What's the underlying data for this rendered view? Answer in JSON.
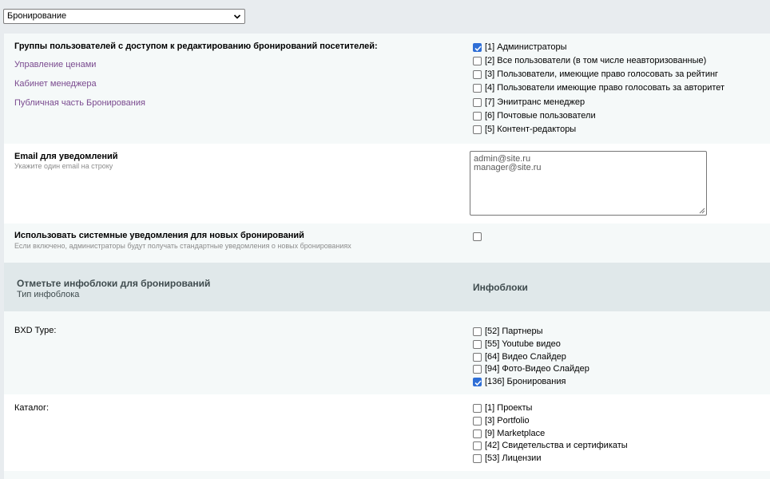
{
  "module_select": {
    "value": "Бронирование"
  },
  "access": {
    "label": "Группы пользователей с доступом к редактированию бронирований посетителей:",
    "links": [
      "Управление ценами",
      "Кабинет менеджера",
      "Публичная часть Бронирования"
    ],
    "groups": [
      {
        "label": "[1] Администраторы",
        "checked": true
      },
      {
        "label": "[2] Все пользователи (в том числе неавторизованные)",
        "checked": false
      },
      {
        "label": "[3] Пользователи, имеющие право голосовать за рейтинг",
        "checked": false
      },
      {
        "label": "[4] Пользователи имеющие право голосовать за авторитет",
        "checked": false
      },
      {
        "label": "[7] Эниитранс менеджер",
        "checked": false
      },
      {
        "label": "[6] Почтовые пользователи",
        "checked": false
      },
      {
        "label": "[5] Контент-редакторы",
        "checked": false
      }
    ]
  },
  "email": {
    "label": "Email для уведомлений",
    "hint": "Укажите один email на строку",
    "lines": [
      "admin@site.ru",
      "manager@site.ru"
    ]
  },
  "system_notify": {
    "label": "Использовать системные уведомления для новых бронирований",
    "hint": "Если включено, администраторы будут получать стандартные уведомления о новых бронированиях",
    "checked": false
  },
  "section": {
    "title": "Отметьте инфоблоки для бронирований",
    "subtitle": "Тип инфоблока",
    "column": "Инфоблоки"
  },
  "iblock_types": [
    {
      "label": "BXD Type:",
      "items": [
        {
          "label": "[52] Партнеры",
          "checked": false
        },
        {
          "label": "[55] Youtube видео",
          "checked": false
        },
        {
          "label": "[64] Видео Слайдер",
          "checked": false
        },
        {
          "label": "[94] Фото-Видео Слайдер",
          "checked": false
        },
        {
          "label": "[136] Бронирования",
          "checked": true
        }
      ]
    },
    {
      "label": "Каталог:",
      "items": [
        {
          "label": "[1] Проекты",
          "checked": false
        },
        {
          "label": "[3] Portfolio",
          "checked": false
        },
        {
          "label": "[9] Marketplace",
          "checked": false
        },
        {
          "label": "[42] Свидетельства и сертификаты",
          "checked": false
        },
        {
          "label": "[53] Лицензии",
          "checked": false
        }
      ]
    }
  ],
  "colors": {
    "link": "#7a4a8f",
    "check": "#2f6fd6",
    "header_bg": "#e0e8ea"
  }
}
